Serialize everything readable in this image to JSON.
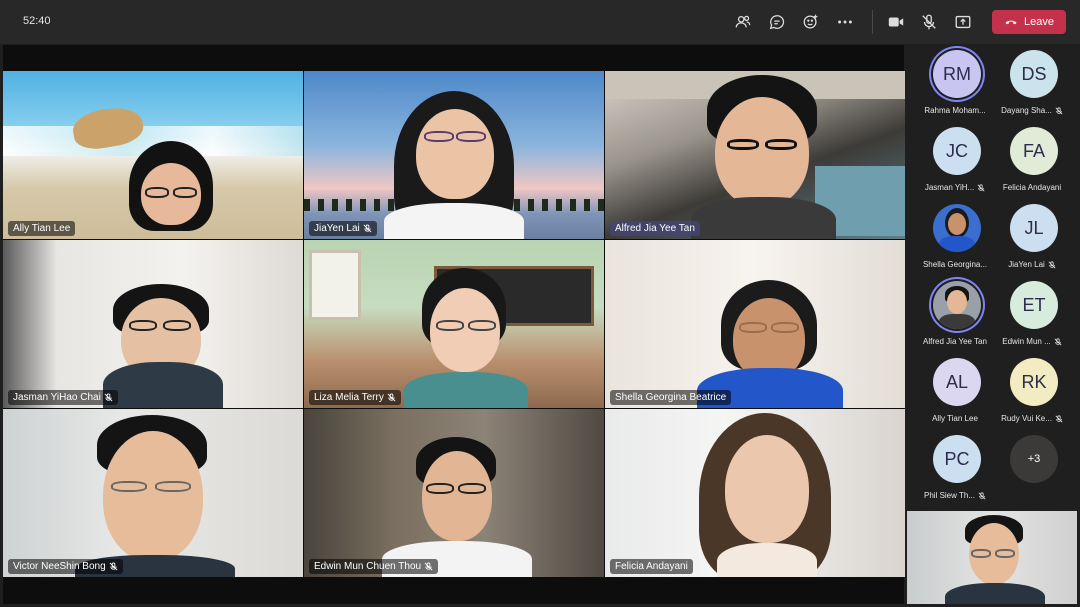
{
  "topbar": {
    "timer": "52:40",
    "icons": [
      "people-icon",
      "chat-icon",
      "reactions-icon",
      "more-icon",
      "camera-icon",
      "mic-muted-icon",
      "share-icon"
    ],
    "leave_label": "Leave",
    "leave_color": "#c4314b"
  },
  "tiles": [
    {
      "name": "Ally Tian Lee",
      "muted": false
    },
    {
      "name": "JiaYen Lai",
      "muted": true
    },
    {
      "name": "Alfred Jia Yee Tan",
      "muted": false,
      "highlight": true
    },
    {
      "name": "Jasman YiHao Chai",
      "muted": true
    },
    {
      "name": "Liza Melia Terry",
      "muted": true
    },
    {
      "name": "Shella Georgina Beatrice",
      "muted": false
    },
    {
      "name": "Victor NeeShin Bong",
      "muted": true
    },
    {
      "name": "Edwin Mun Chuen Thou",
      "muted": true
    },
    {
      "name": "Felicia Andayani",
      "muted": false
    }
  ],
  "participants": [
    {
      "initials": "RM",
      "name": "Rahma Moham...",
      "muted": false,
      "photo": false,
      "ring": true,
      "color": "#c8c5f0"
    },
    {
      "initials": "DS",
      "name": "Dayang Sha...",
      "muted": true,
      "photo": false,
      "color": "#cbe3ec"
    },
    {
      "initials": "JC",
      "name": "Jasman YiH...",
      "muted": true,
      "photo": false,
      "color": "#cbdff0"
    },
    {
      "initials": "FA",
      "name": "Felicia Andayani",
      "muted": false,
      "photo": false,
      "color": "#e1ecd8"
    },
    {
      "initials": "",
      "name": "Shella Georgina...",
      "muted": false,
      "photo": true,
      "color": "#3a6fd0"
    },
    {
      "initials": "JL",
      "name": "JiaYen Lai",
      "muted": true,
      "photo": false,
      "color": "#cbdff0"
    },
    {
      "initials": "",
      "name": "Alfred Jia Yee Tan",
      "muted": false,
      "photo": true,
      "ring": true,
      "color": "#9aa0a8"
    },
    {
      "initials": "ET",
      "name": "Edwin Mun ...",
      "muted": true,
      "photo": false,
      "color": "#d7ecdc"
    },
    {
      "initials": "AL",
      "name": "Ally Tian Lee",
      "muted": false,
      "photo": false,
      "color": "#dcd7f0"
    },
    {
      "initials": "RK",
      "name": "Rudy Vui Ke...",
      "muted": true,
      "photo": false,
      "color": "#f3ecc2"
    },
    {
      "initials": "PC",
      "name": "Phil Siew Th...",
      "muted": true,
      "photo": false,
      "color": "#cbdff0"
    },
    {
      "initials": "+3",
      "name": "",
      "muted": false,
      "photo": false,
      "more": true,
      "color": "#3b3a39"
    }
  ]
}
